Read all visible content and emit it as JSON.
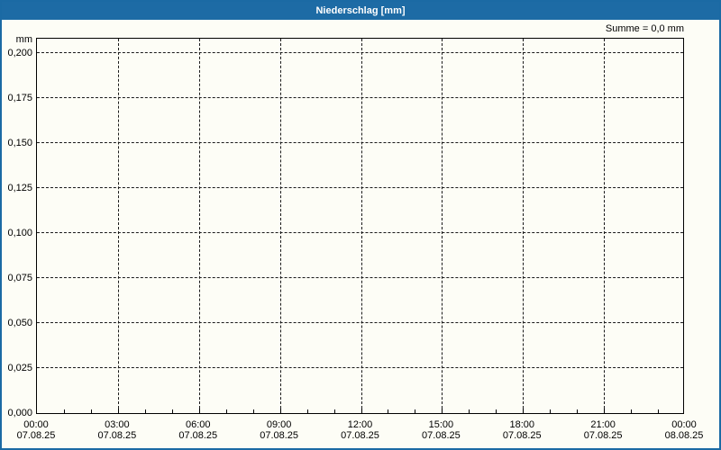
{
  "window": {
    "title": "Niederschlag [mm]"
  },
  "summary": {
    "text": "Summe = 0,0 mm"
  },
  "colors": {
    "titlebar": "#1d6ba5",
    "window_border": "#1b6aa4",
    "background": "#fdfdf6",
    "grid": "#1a1a1a",
    "axis": "#000000",
    "title_text": "#ffffff"
  },
  "chart_data": {
    "type": "bar",
    "title": "Niederschlag [mm]",
    "unit_label": "mm",
    "xlabel": "",
    "ylabel": "mm",
    "ylim": [
      0,
      0.209
    ],
    "grid": "dashed",
    "legend": "none",
    "y_ticks": [
      {
        "value": 0.0,
        "label": "0,000"
      },
      {
        "value": 0.025,
        "label": "0,025"
      },
      {
        "value": 0.05,
        "label": "0,050"
      },
      {
        "value": 0.075,
        "label": "0,075"
      },
      {
        "value": 0.1,
        "label": "0,100"
      },
      {
        "value": 0.125,
        "label": "0,125"
      },
      {
        "value": 0.15,
        "label": "0,150"
      },
      {
        "value": 0.175,
        "label": "0,175"
      },
      {
        "value": 0.2,
        "label": "0,200"
      }
    ],
    "x_axis": {
      "range_hours": 24,
      "minor_tick_hours": 1,
      "major_tick_hours": 3,
      "major_ticks": [
        {
          "time": "00:00",
          "date": "07.08.25"
        },
        {
          "time": "03:00",
          "date": "07.08.25"
        },
        {
          "time": "06:00",
          "date": "07.08.25"
        },
        {
          "time": "09:00",
          "date": "07.08.25"
        },
        {
          "time": "12:00",
          "date": "07.08.25"
        },
        {
          "time": "15:00",
          "date": "07.08.25"
        },
        {
          "time": "18:00",
          "date": "07.08.25"
        },
        {
          "time": "21:00",
          "date": "07.08.25"
        },
        {
          "time": "00:00",
          "date": "08.08.25"
        }
      ]
    },
    "series": [
      {
        "name": "Niederschlag",
        "unit": "mm",
        "values": [],
        "sum": 0.0,
        "note": "no precipitation recorded in shown period; plot area empty"
      }
    ],
    "annotations": [
      "Summe = 0,0 mm"
    ]
  }
}
